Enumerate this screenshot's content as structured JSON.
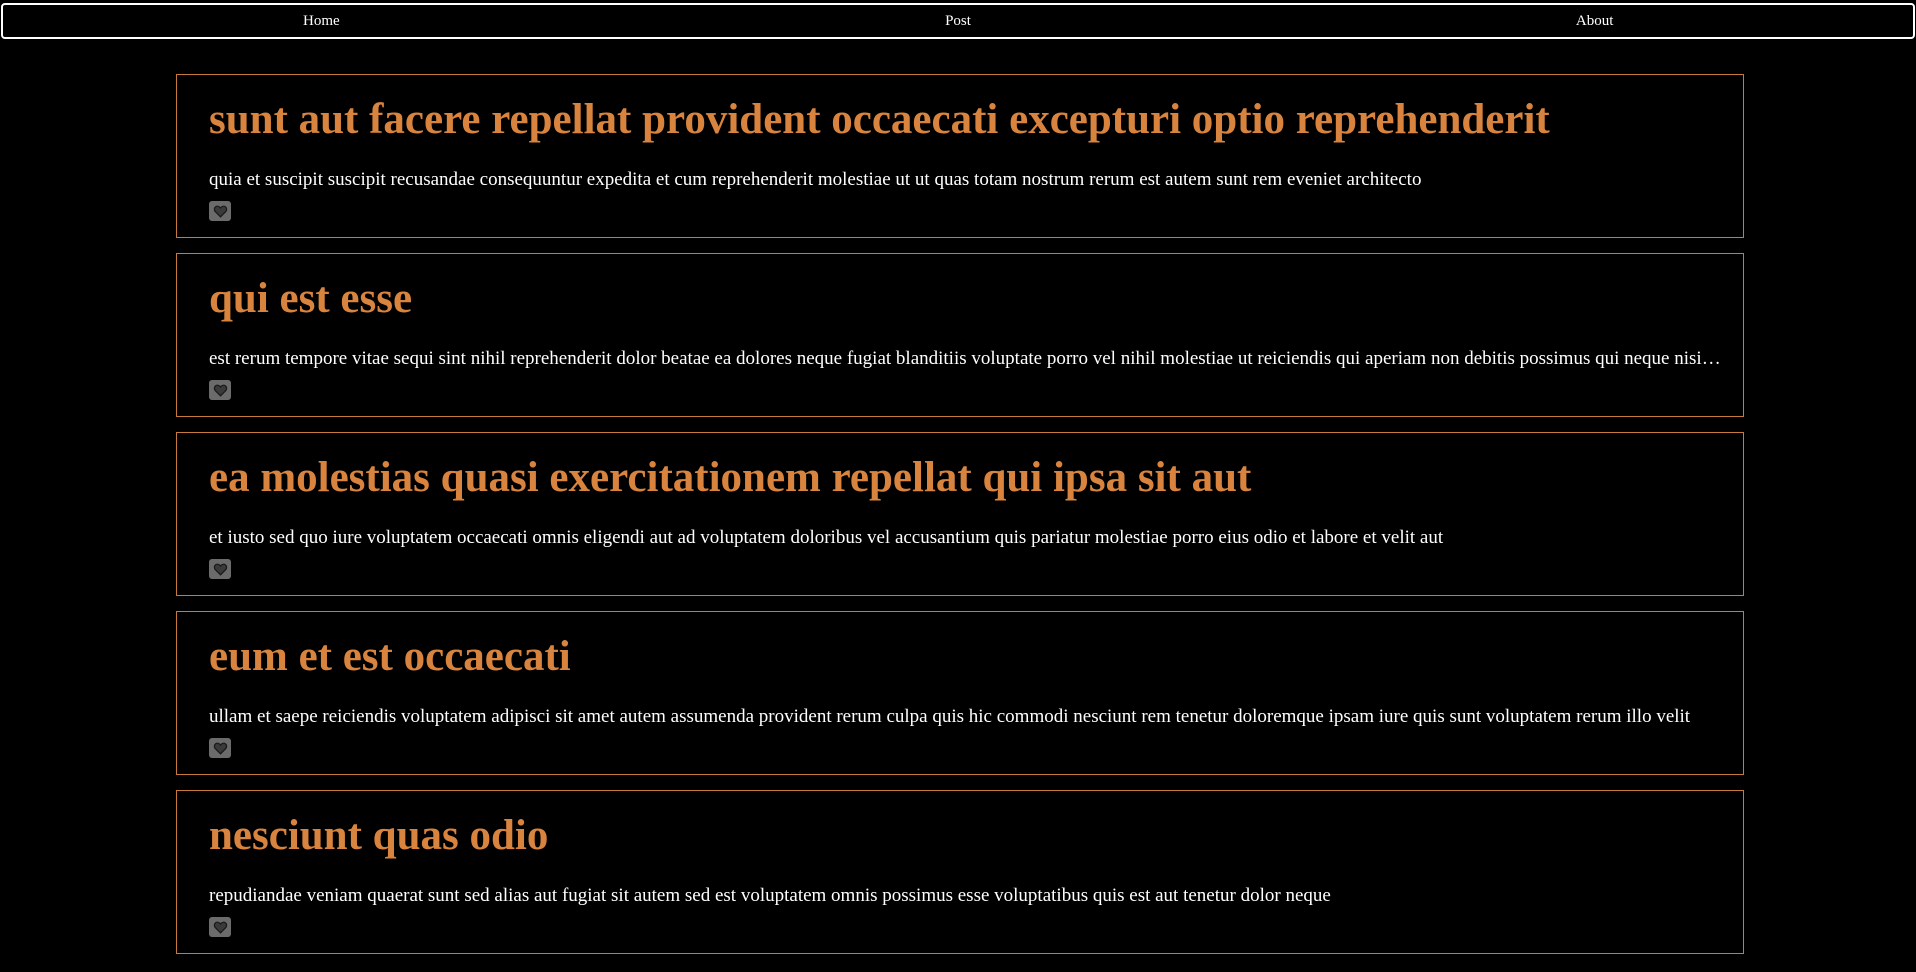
{
  "nav": {
    "items": [
      {
        "label": "Home"
      },
      {
        "label": "Post"
      },
      {
        "label": "About"
      }
    ]
  },
  "posts": [
    {
      "title": "sunt aut facere repellat provident occaecati excepturi optio reprehenderit",
      "body": "quia et suscipit suscipit recusandae consequuntur expedita et cum reprehenderit molestiae ut ut quas totam nostrum rerum est autem sunt rem eveniet architecto",
      "like_icon": "heart-icon"
    },
    {
      "title": "qui est esse",
      "body": "est rerum tempore vitae sequi sint nihil reprehenderit dolor beatae ea dolores neque fugiat blanditiis voluptate porro vel nihil molestiae ut reiciendis qui aperiam non debitis possimus qui neque nisi nulla",
      "like_icon": "heart-icon"
    },
    {
      "title": "ea molestias quasi exercitationem repellat qui ipsa sit aut",
      "body": "et iusto sed quo iure voluptatem occaecati omnis eligendi aut ad voluptatem doloribus vel accusantium quis pariatur molestiae porro eius odio et labore et velit aut",
      "like_icon": "heart-icon"
    },
    {
      "title": "eum et est occaecati",
      "body": "ullam et saepe reiciendis voluptatem adipisci sit amet autem assumenda provident rerum culpa quis hic commodi nesciunt rem tenetur doloremque ipsam iure quis sunt voluptatem rerum illo velit",
      "like_icon": "heart-icon"
    },
    {
      "title": "nesciunt quas odio",
      "body": "repudiandae veniam quaerat sunt sed alias aut fugiat sit autem sed est voluptatem omnis possimus esse voluptatibus quis est aut tenetur dolor neque",
      "like_icon": "heart-icon"
    }
  ],
  "colors": {
    "background": "#000000",
    "title": "#d9843e",
    "card_border": "#c87a3c",
    "body_text": "#ffffff",
    "like_button": "#6b6b6b"
  }
}
